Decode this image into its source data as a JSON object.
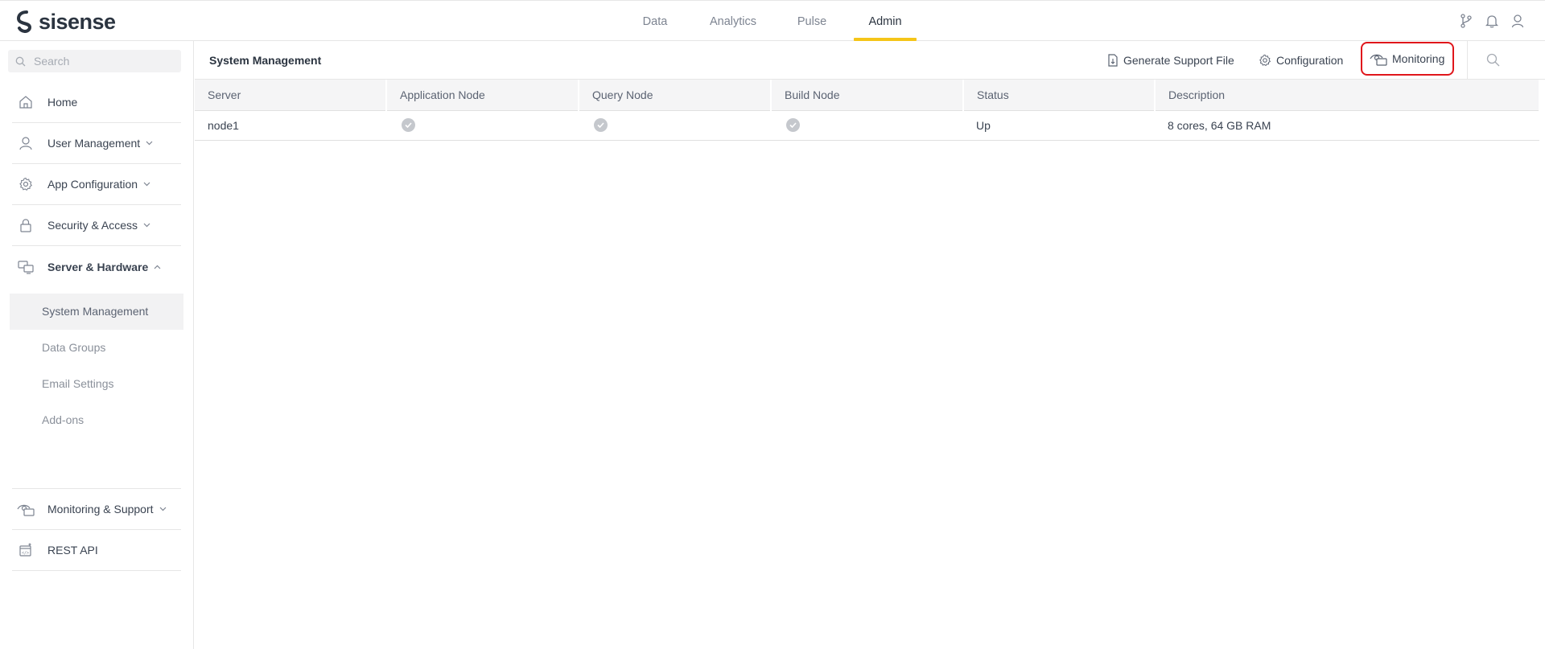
{
  "app": {
    "logo_text": "sisense"
  },
  "nav": {
    "tabs": [
      {
        "label": "Data"
      },
      {
        "label": "Analytics"
      },
      {
        "label": "Pulse"
      },
      {
        "label": "Admin",
        "active": true
      }
    ],
    "accent_color": "#f5c518"
  },
  "top_icons": [
    "git-branch-icon",
    "bell-icon",
    "user-icon"
  ],
  "sidebar": {
    "search_placeholder": "Search",
    "items": [
      {
        "label": "Home",
        "icon": "home-icon"
      },
      {
        "label": "User Management",
        "icon": "user-icon",
        "expandable": true
      },
      {
        "label": "App Configuration",
        "icon": "gear-icon",
        "expandable": true
      },
      {
        "label": "Security & Access",
        "icon": "lock-icon",
        "expandable": true
      },
      {
        "label": "Server & Hardware",
        "icon": "servers-icon",
        "expanded": true
      }
    ],
    "sub_items": [
      {
        "label": "System Management",
        "active": true
      },
      {
        "label": "Data Groups"
      },
      {
        "label": "Email Settings"
      },
      {
        "label": "Add-ons"
      }
    ],
    "items_bottom": [
      {
        "label": "Monitoring & Support",
        "icon": "monitoring-eye-icon",
        "expandable": true
      },
      {
        "label": "REST API",
        "icon": "api-icon"
      }
    ]
  },
  "main": {
    "title": "System Management",
    "toolbar": {
      "generate_label": "Generate Support File",
      "configuration_label": "Configuration",
      "monitoring_label": "Monitoring",
      "highlight_color": "#e0161b"
    },
    "table": {
      "columns": [
        "Server",
        "Application Node",
        "Query Node",
        "Build Node",
        "Status",
        "Description"
      ],
      "rows": [
        {
          "server": "node1",
          "application_node": true,
          "query_node": true,
          "build_node": true,
          "status": "Up",
          "description": "8 cores, 64 GB RAM"
        }
      ]
    }
  }
}
